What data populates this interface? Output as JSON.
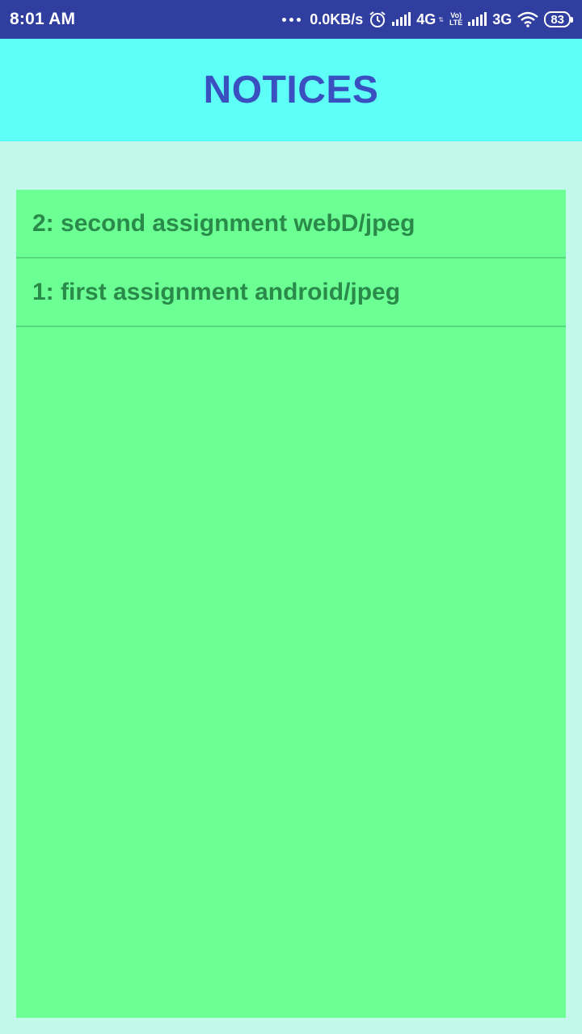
{
  "status_bar": {
    "time": "8:01 AM",
    "net_speed": "0.0KB/s",
    "network_1": "4G",
    "volte_top": "Vo)",
    "volte_bottom": "LTE",
    "network_2": "3G",
    "battery": "83",
    "icons": [
      "more-dots-icon",
      "alarm-icon",
      "signal-icon",
      "volte-icon",
      "signal-icon",
      "wifi-icon",
      "battery-icon"
    ]
  },
  "header": {
    "title": "NOTICES",
    "bg_color": "#5dfff6",
    "title_color": "#3a4fc0"
  },
  "notices": [
    {
      "text": "2: second assignment webD/jpeg"
    },
    {
      "text": "1: first assignment android/jpeg"
    }
  ],
  "colors": {
    "status_bar": "#303f9f",
    "page_bg": "#c2f9ea",
    "panel_bg": "#6cff94",
    "item_text": "#2a8a4a"
  }
}
